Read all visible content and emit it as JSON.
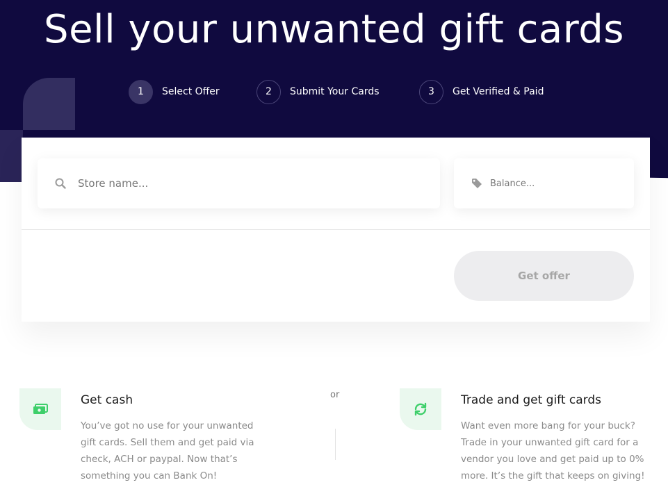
{
  "colors": {
    "hero_bg": "#100a3f",
    "accent_green": "#3ecf6a",
    "button_disabled_bg": "#ededef",
    "button_disabled_text": "#a6a6a6"
  },
  "hero": {
    "title": "Sell your unwanted gift cards",
    "steps": [
      {
        "number": "1",
        "label": "Select Offer",
        "active": true
      },
      {
        "number": "2",
        "label": "Submit Your Cards",
        "active": false
      },
      {
        "number": "3",
        "label": "Get Verified & Paid",
        "active": false
      }
    ]
  },
  "form": {
    "store_placeholder": "Store name...",
    "store_value": "",
    "store_icon": "search-icon",
    "balance_placeholder": "Balance...",
    "balance_value": "",
    "balance_icon": "tag-icon",
    "submit_label": "Get offer"
  },
  "features": {
    "or_label": "or",
    "cash": {
      "icon": "money-icon",
      "title": "Get cash",
      "lines": [
        "You’ve got no use for your unwanted",
        "gift cards. Sell them and get paid via",
        "check, ACH or paypal. Now that’s",
        "something you can Bank On!"
      ]
    },
    "trade": {
      "icon": "refresh-icon",
      "title": "Trade and get gift cards",
      "lines": [
        "Want even more bang for your buck?",
        "Trade in your unwanted gift card for a",
        "vendor you love and get paid up to 0%",
        "more. It’s the gift that keeps on giving!"
      ]
    }
  }
}
